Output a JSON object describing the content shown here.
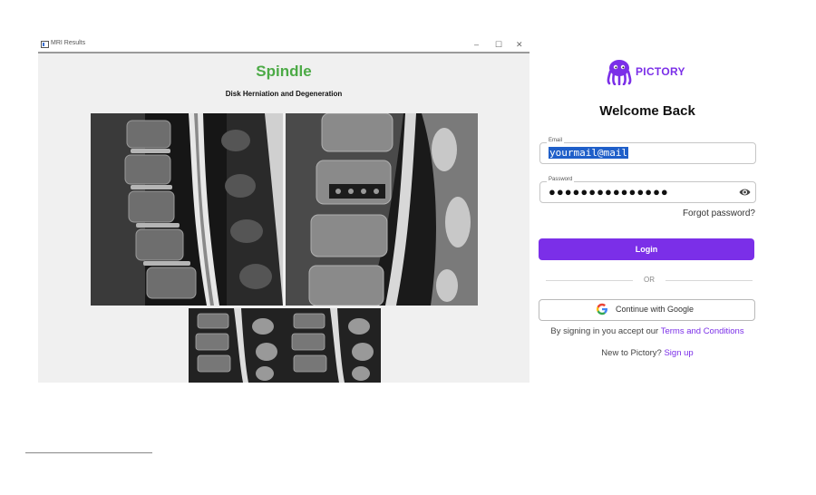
{
  "mri_window": {
    "title": "MRI Results",
    "controls": {
      "minimize": "–",
      "maximize": "☐",
      "close": "✕"
    },
    "heading": "Spindle",
    "subheading": "Disk Herniation and Degeneration",
    "heading_color": "#4caa46"
  },
  "login": {
    "brand": "PICTORY",
    "brand_color": "#7b2fe8",
    "welcome": "Welcome Back",
    "email": {
      "label": "Email",
      "value": "yourmail@mail"
    },
    "password": {
      "label": "Password",
      "value": "●●●●●●●●●●●●●●●"
    },
    "forgot": "Forgot password?",
    "login_button": "Login",
    "or": "OR",
    "google_button": "Continue with Google",
    "terms_prefix": "By signing in you accept our ",
    "terms_link": "Terms and Conditions",
    "signup_prefix": "New to Pictory? ",
    "signup_link": "Sign up"
  },
  "icons": {
    "app": "app-window-icon",
    "eye": "eye-icon",
    "google": "google-g-icon",
    "octopus": "octopus-logo-icon"
  }
}
